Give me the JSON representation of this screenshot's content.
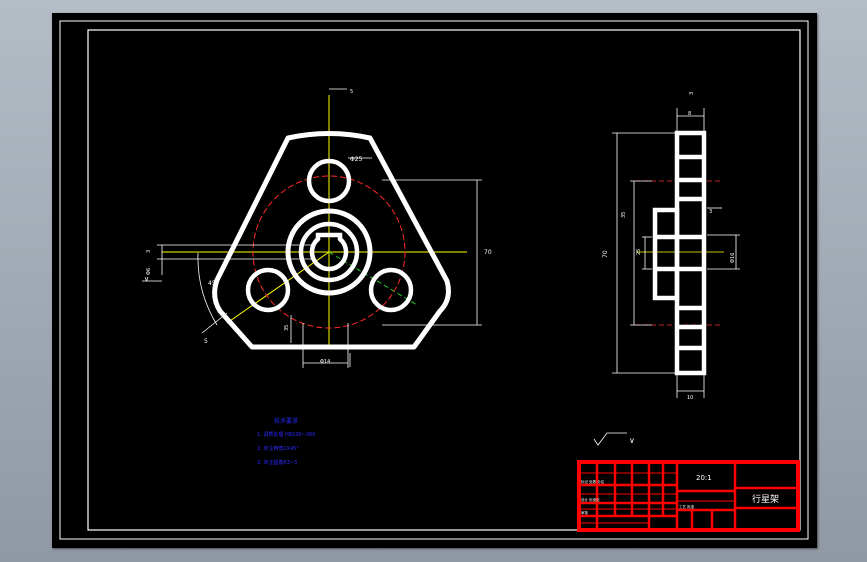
{
  "tech": {
    "title": "技术要求",
    "items": [
      "1. 调质处理 HB230~260",
      "2. 未注倒角1X45°",
      "3. 未注圆角R3~5"
    ]
  },
  "titleblock": {
    "scale": "20:1",
    "part_name": "行星架",
    "sub_rows": [
      "标记 处数 分区",
      "设计 标准化",
      "审核",
      "工艺 批准"
    ]
  },
  "dims": {
    "front_height": "70",
    "front_center": "35",
    "front_hole": "Φ25",
    "front_bore": "Φ14",
    "front_groove": "Φ6",
    "front_angle": "45°",
    "front_key": "5",
    "front_keyway": "3",
    "side_height": "70",
    "side_inner": "35",
    "side_hub": "25",
    "side_top": "8",
    "side_bottom": "10",
    "side_slot": "3",
    "side_dia": "Φ16",
    "roughness": "∨"
  },
  "colors": {
    "outline": "#ffffff",
    "dim": "#ffffff",
    "center": "#ffff00",
    "hidden": "#ff2a2a",
    "green": "#22cc22",
    "text_blue": "#2a2aff",
    "titleblock": "#ff0000"
  }
}
